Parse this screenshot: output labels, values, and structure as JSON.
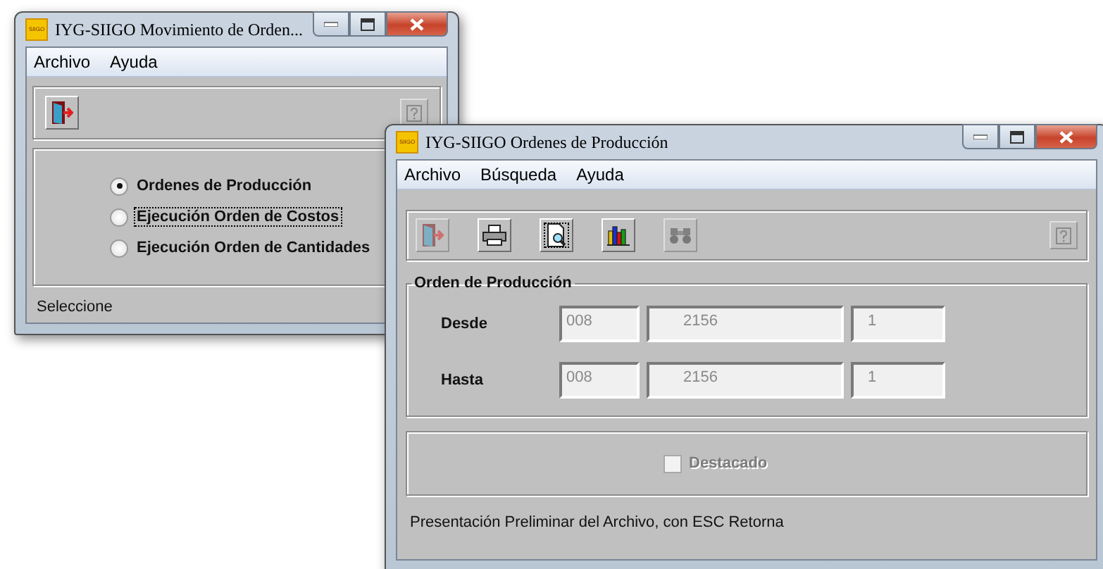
{
  "windows": [
    {
      "logo": "SIIGO",
      "title": "IYG-SIIGO Movimiento de Orden...",
      "menu": [
        "Archivo",
        "Ayuda"
      ],
      "tools": [
        {
          "kind": "exit",
          "disabled": false,
          "focused": false
        }
      ],
      "radios": [
        {
          "label": "Ordenes de Producción",
          "selected": true,
          "focused": false
        },
        {
          "label": "Ejecución Orden de Costos",
          "selected": false,
          "focused": true
        },
        {
          "label": "Ejecución Orden de Cantidades",
          "selected": false,
          "focused": false
        }
      ],
      "status": "Seleccione"
    },
    {
      "logo": "SIIGO",
      "title": "IYG-SIIGO Ordenes de Producción",
      "menu": [
        "Archivo",
        "Búsqueda",
        "Ayuda"
      ],
      "tools": [
        {
          "kind": "exit",
          "disabled": true,
          "focused": false
        },
        {
          "kind": "print",
          "disabled": false,
          "focused": false
        },
        {
          "kind": "preview",
          "disabled": false,
          "focused": true
        },
        {
          "kind": "chart",
          "disabled": false,
          "focused": false
        },
        {
          "kind": "find",
          "disabled": true,
          "focused": false
        }
      ],
      "group": {
        "legend": "Orden de Producción",
        "rows": [
          {
            "label": "Desde",
            "fields": [
              "008",
              "2156",
              "1"
            ],
            "disabled": true
          },
          {
            "label": "Hasta",
            "fields": [
              "008",
              "2156",
              "1"
            ],
            "disabled": true
          }
        ]
      },
      "checkbox": {
        "label": "Destacado",
        "checked": false,
        "disabled": true
      },
      "status": "Presentación Preliminar del Archivo, con ESC Retorna"
    }
  ]
}
